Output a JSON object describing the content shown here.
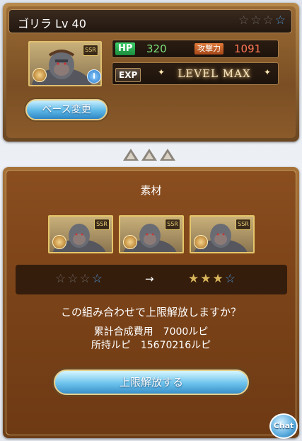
{
  "character": {
    "name": "ゴリラ Lv 40",
    "rarity_stars": [
      "grey",
      "grey",
      "grey",
      "blue"
    ],
    "hp_label": "HP",
    "hp_value": "320",
    "atk_label": "攻撃力",
    "atk_value": "1091",
    "exp_label": "EXP",
    "level_status": "LEVEL MAX",
    "badge": "SSR",
    "base_change_label": "ベース変更"
  },
  "materials": {
    "title": "素材",
    "card_badge": "SSR",
    "cards": [
      {
        "badge": "SSR"
      },
      {
        "badge": "SSR"
      },
      {
        "badge": "SSR"
      }
    ],
    "current_stars": [
      "grey",
      "grey",
      "grey",
      "blue"
    ],
    "arrow": "→",
    "result_stars": [
      "gold",
      "gold",
      "gold",
      "blue"
    ]
  },
  "confirm": {
    "question": "この組み合わせで上限解放しますか？",
    "total_cost": "累計合成費用　7000ルピ",
    "owned_rupie": "所持ルピ　15670216ルピ",
    "button_label": "上限解放する"
  },
  "chat": {
    "label": "Chat"
  },
  "colors": {
    "accent_blue": "#4a8fcb",
    "hp_green": "#7de07a",
    "atk_red": "#ff7755",
    "frame_gold": "#e5c66a"
  }
}
